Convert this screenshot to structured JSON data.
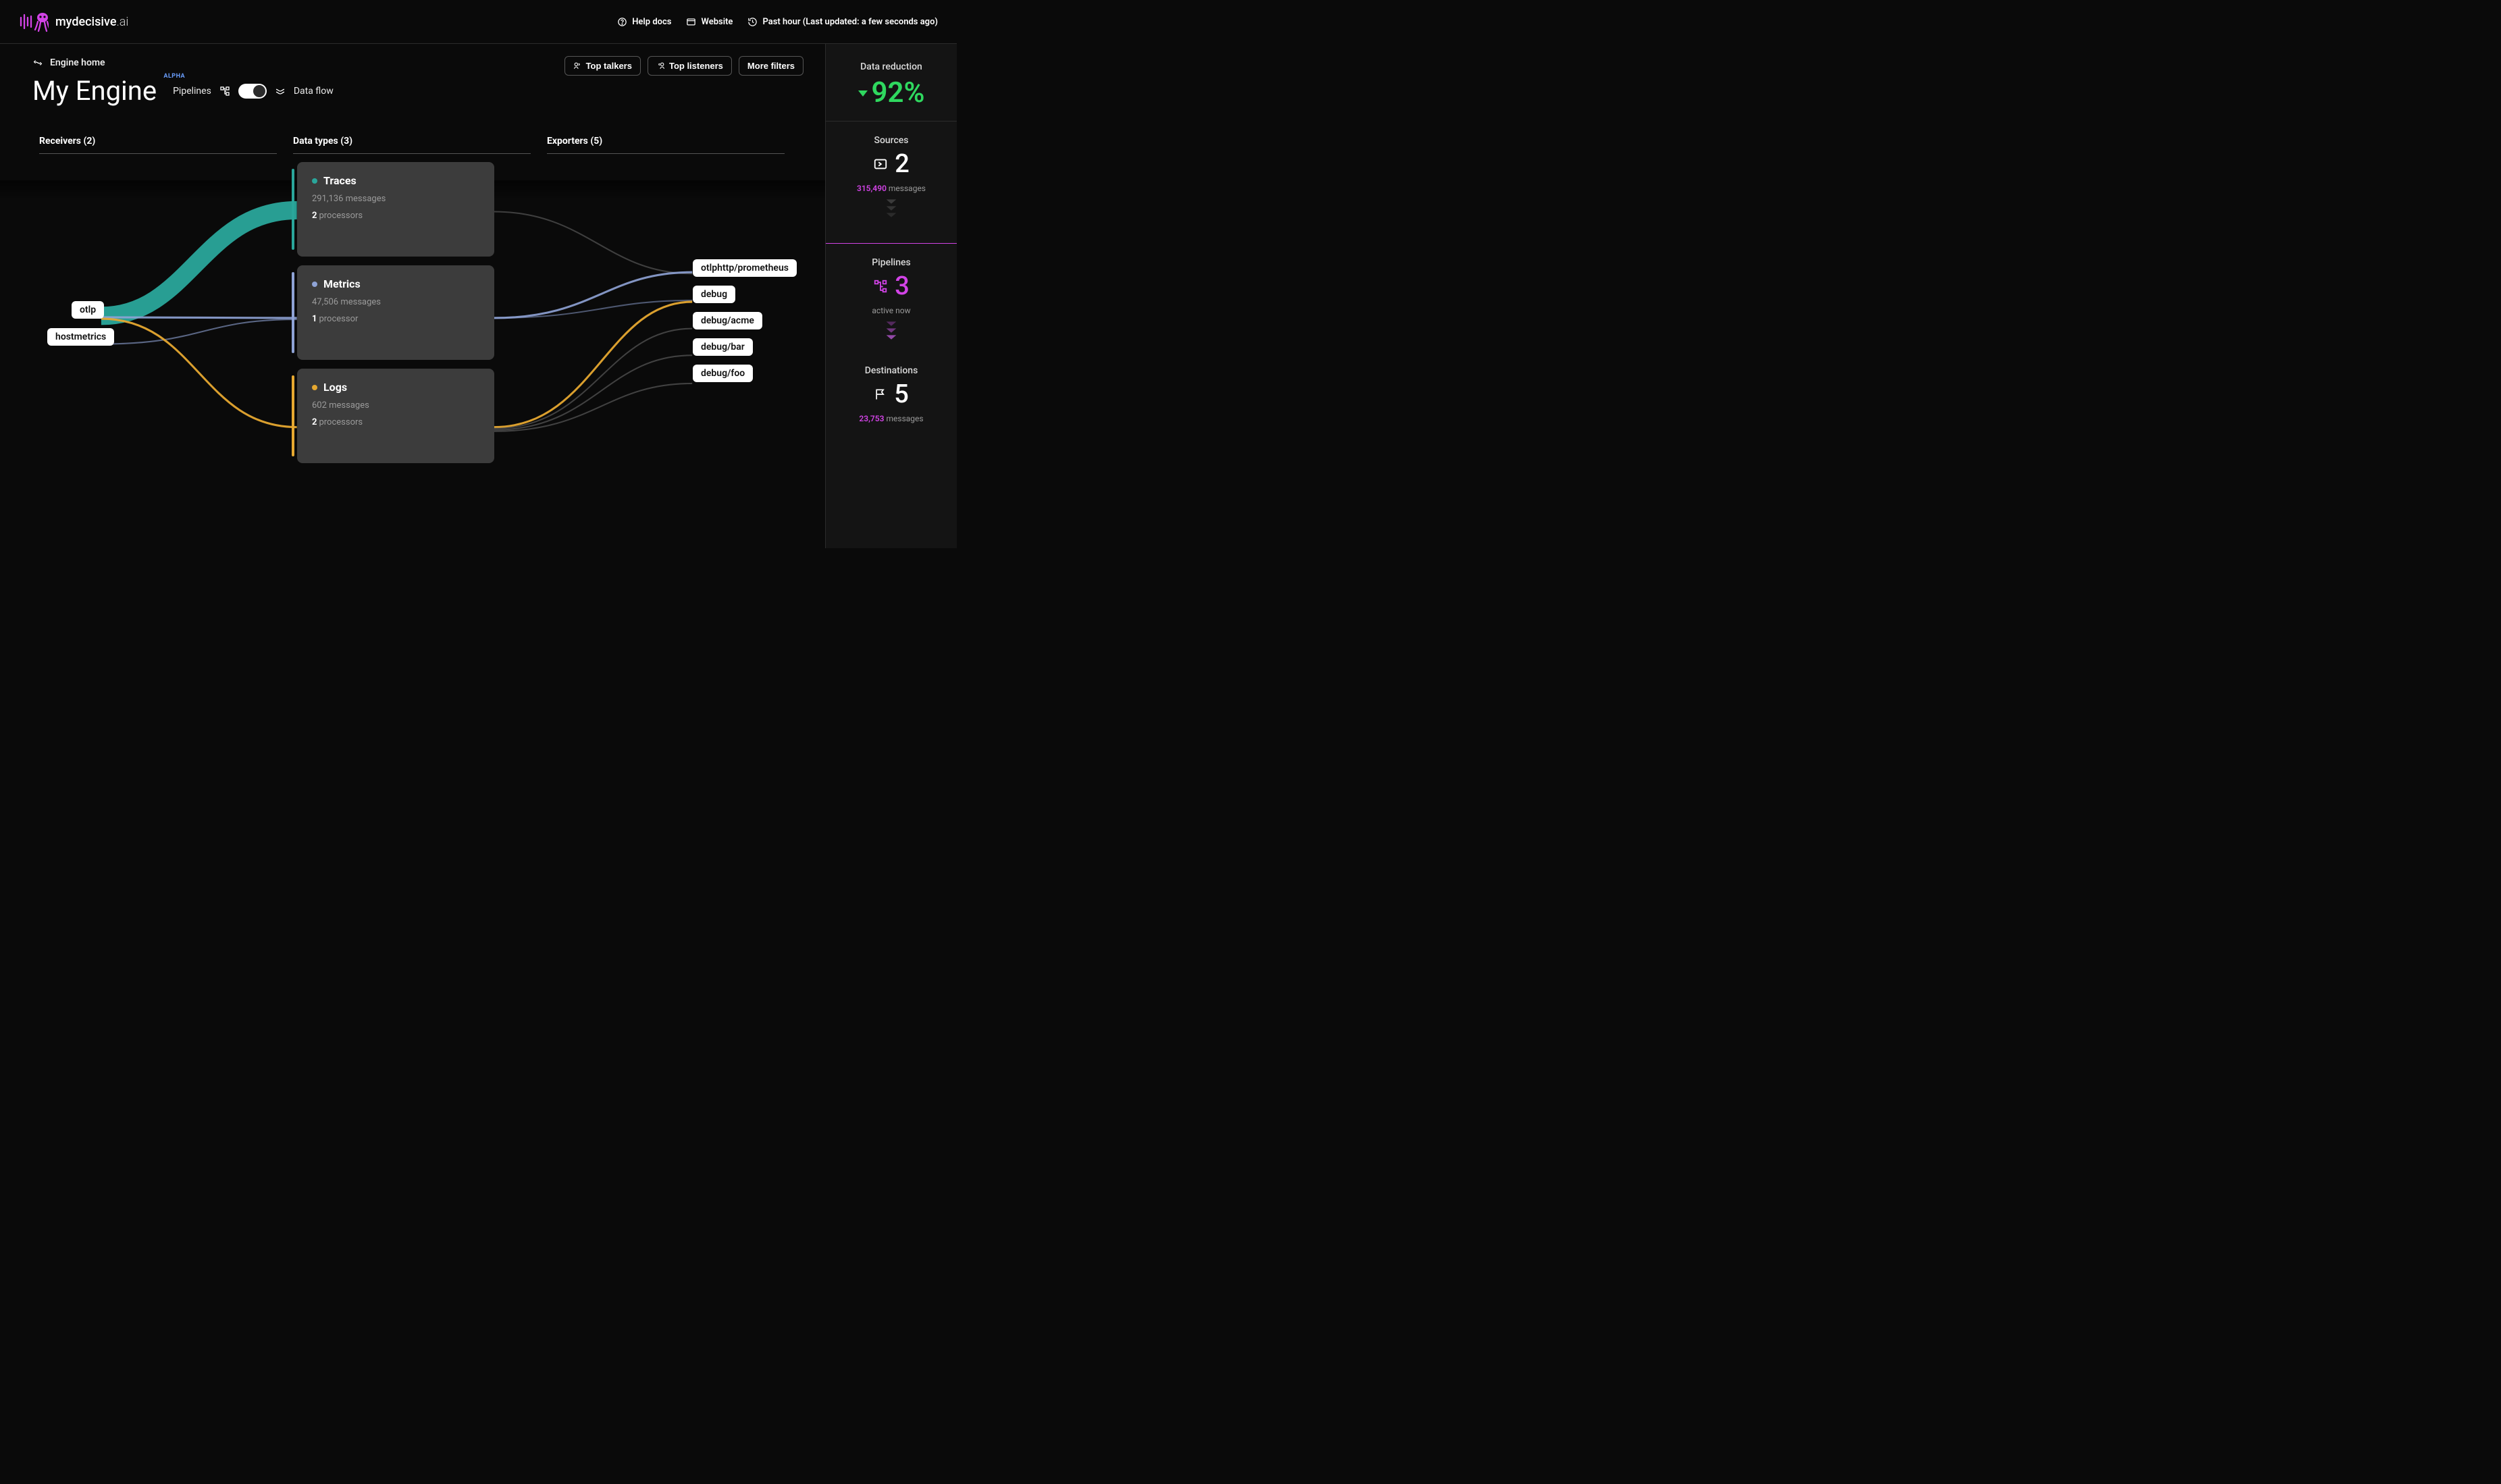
{
  "brand": {
    "name_bold": "mydecisive",
    "name_thin": ".ai"
  },
  "nav": {
    "help": "Help docs",
    "website": "Website",
    "time_range": "Past hour (Last updated: a few seconds ago)"
  },
  "breadcrumb": "Engine home",
  "title": "My Engine",
  "badge": "ALPHA",
  "view": {
    "pipelines": "Pipelines",
    "dataflow": "Data flow"
  },
  "actions": {
    "top_talkers": "Top talkers",
    "top_listeners": "Top listeners",
    "more_filters": "More filters"
  },
  "columns": {
    "receivers": "Receivers (2)",
    "datatypes": "Data types (3)",
    "exporters": "Exporters (5)"
  },
  "receivers": [
    {
      "label": "otlp"
    },
    {
      "label": "hostmetrics"
    }
  ],
  "datatypes": [
    {
      "name": "Traces",
      "color": "#2aa69b",
      "messages": "291,136 messages",
      "processors_n": "2",
      "processors_w": "processors"
    },
    {
      "name": "Metrics",
      "color": "#8fa3d6",
      "messages": "47,506 messages",
      "processors_n": "1",
      "processors_w": "processor"
    },
    {
      "name": "Logs",
      "color": "#e6a830",
      "messages": "602 messages",
      "processors_n": "2",
      "processors_w": "processors"
    }
  ],
  "exporters": [
    {
      "label": "otlphttp/prometheus"
    },
    {
      "label": "debug"
    },
    {
      "label": "debug/acme"
    },
    {
      "label": "debug/bar"
    },
    {
      "label": "debug/foo"
    }
  ],
  "sidebar": {
    "reduction": {
      "label": "Data reduction",
      "value": "92%"
    },
    "sources": {
      "label": "Sources",
      "count": "2",
      "msgs": "315,490",
      "msgs_w": "messages"
    },
    "pipelines": {
      "label": "Pipelines",
      "count": "3",
      "sub": "active now"
    },
    "destinations": {
      "label": "Destinations",
      "count": "5",
      "msgs": "23,753",
      "msgs_w": "messages"
    }
  }
}
